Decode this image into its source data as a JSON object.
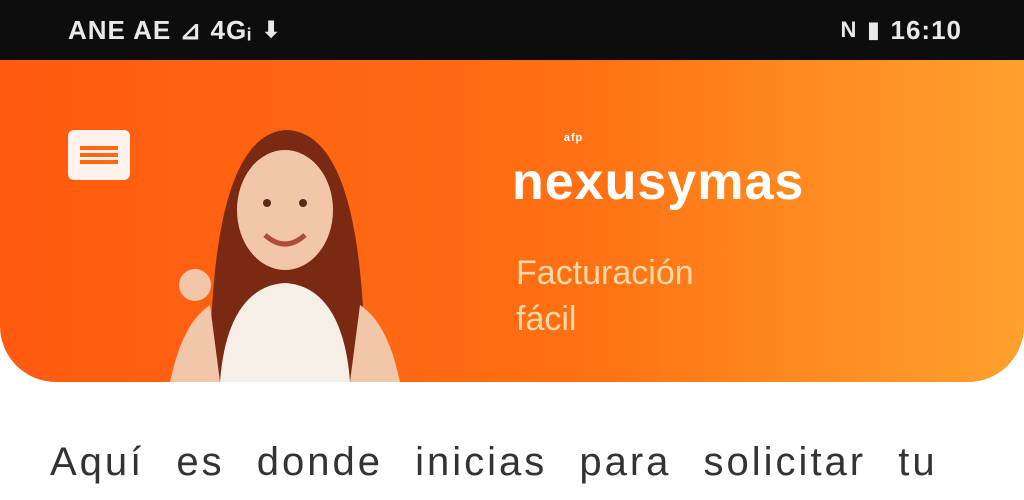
{
  "status_bar": {
    "left_text": "ANE AE ⊿ 4Gᵢ",
    "left_icons": [
      "signal-icon",
      "wifi-icon",
      "download-icon"
    ],
    "right_text": "16:10",
    "right_icons": [
      "nfc-icon",
      "battery-icon"
    ]
  },
  "banner": {
    "brand_name": "nexusymas",
    "brand_superscript": "ᵃᶠᵖ",
    "subtitle_line1": "Facturación",
    "subtitle_line2": "fácil"
  },
  "content": {
    "intro_text": "Aquí es donde inicias para solicitar tu"
  },
  "colors": {
    "status_bar_bg": "#0d0d0d",
    "banner_start": "#ff5a10",
    "banner_end": "#ff8a1a",
    "text_dark": "#333333",
    "subtitle": "#ffd9a8"
  }
}
